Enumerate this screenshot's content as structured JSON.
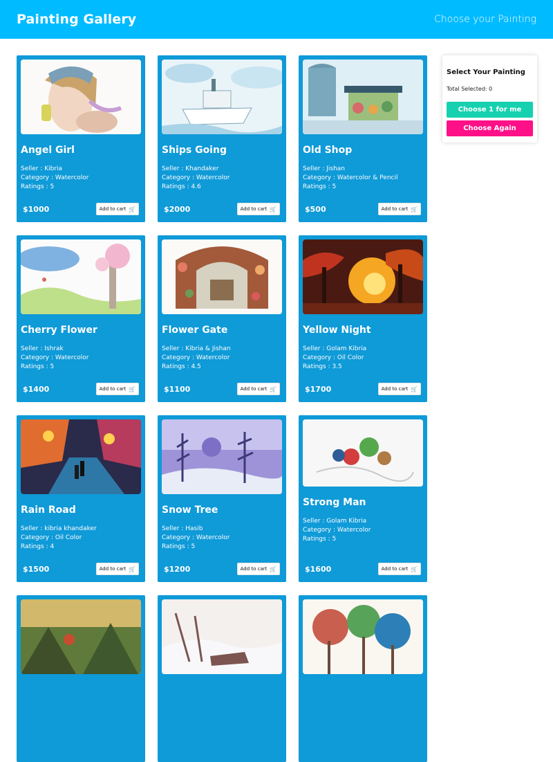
{
  "header": {
    "brand": "Painting Gallery",
    "tagline": "Choose your Painting"
  },
  "cart_button_label": "Add to cart",
  "paintings": [
    {
      "title": "Angel Girl",
      "seller": "Seller : Kibria",
      "category": "Category : Watercolor",
      "ratings": "Ratings : 5",
      "price": "$1000"
    },
    {
      "title": "Ships Going",
      "seller": "Seller : Khandaker",
      "category": "Category : Watercolor",
      "ratings": "Ratings : 4.6",
      "price": "$2000"
    },
    {
      "title": "Old Shop",
      "seller": "Seller : Jishan",
      "category": "Category : Watercolor & Pencil",
      "ratings": "Ratings : 5",
      "price": "$500"
    },
    {
      "title": "Cherry Flower",
      "seller": "Seller : Ishrak",
      "category": "Category : Watercolor",
      "ratings": "Ratings : 5",
      "price": "$1400"
    },
    {
      "title": "Flower Gate",
      "seller": "Seller : Kibria & Jishan",
      "category": "Category : Watercolor",
      "ratings": "Ratings : 4.5",
      "price": "$1100"
    },
    {
      "title": "Yellow Night",
      "seller": "Seller : Golam Kibria",
      "category": "Category : Oil Color",
      "ratings": "Ratings : 3.5",
      "price": "$1700"
    },
    {
      "title": "Rain Road",
      "seller": "Seller : kibria khandaker",
      "category": "Category : Oil Color",
      "ratings": "Ratings : 4",
      "price": "$1500"
    },
    {
      "title": "Snow Tree",
      "seller": "Seller : Hasib",
      "category": "Category : Watercolor",
      "ratings": "Ratings : 5",
      "price": "$1200"
    },
    {
      "title": "Strong Man",
      "seller": "Seller : Golam Kibria",
      "category": "Category : Watercolor",
      "ratings": "Ratings : 5",
      "price": "$1600"
    },
    {
      "title": "",
      "seller": "",
      "category": "",
      "ratings": "",
      "price": ""
    },
    {
      "title": "",
      "seller": "",
      "category": "",
      "ratings": "",
      "price": ""
    },
    {
      "title": "",
      "seller": "",
      "category": "",
      "ratings": "",
      "price": ""
    }
  ],
  "sidebar": {
    "title": "Select Your Painting",
    "total_selected": "Total Selected: 0",
    "choose_button": "Choose 1 for me",
    "again_button": "Choose Again"
  }
}
